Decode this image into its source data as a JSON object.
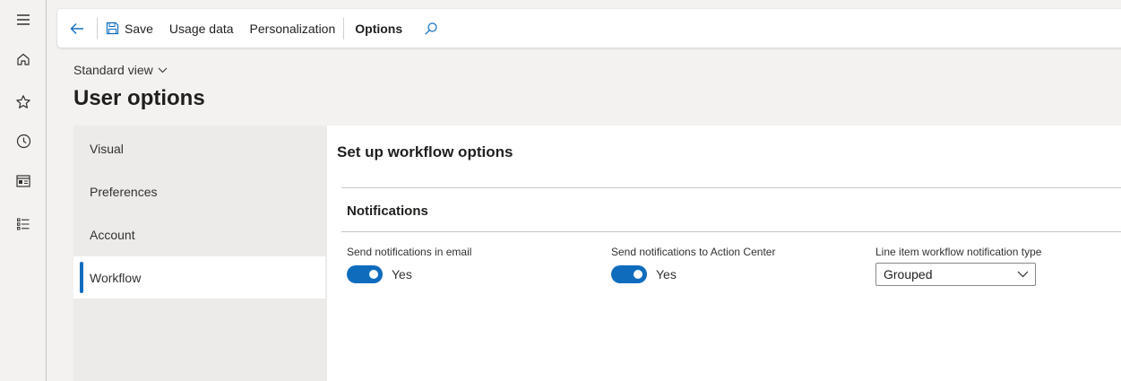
{
  "toolbar": {
    "save_label": "Save",
    "usage_label": "Usage data",
    "personalization_label": "Personalization",
    "options_label": "Options"
  },
  "page": {
    "view_selector": "Standard view",
    "title": "User options"
  },
  "tabs": [
    {
      "label": "Visual",
      "selected": false
    },
    {
      "label": "Preferences",
      "selected": false
    },
    {
      "label": "Account",
      "selected": false
    },
    {
      "label": "Workflow",
      "selected": true
    }
  ],
  "content": {
    "section_title": "Set up workflow options",
    "group_title": "Notifications",
    "fields": {
      "email_label": "Send notifications in email",
      "email_value": "Yes",
      "action_center_label": "Send notifications to Action Center",
      "action_center_value": "Yes",
      "line_item_label": "Line item workflow notification type",
      "line_item_value": "Grouped"
    }
  },
  "icons": {
    "rail": [
      "hamburger-icon",
      "home-icon",
      "star-icon",
      "clock-icon",
      "workspace-icon",
      "list-icon"
    ],
    "toolbar": [
      "back-arrow-icon",
      "save-icon",
      "search-icon",
      "chevron-down-icon"
    ]
  },
  "colors": {
    "accent": "#0f6cbd",
    "nav_background": "#f3f2f1",
    "panel_background": "#ffffff"
  }
}
